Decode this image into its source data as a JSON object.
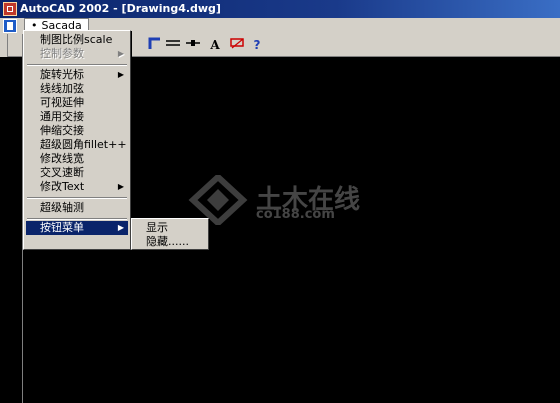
{
  "window": {
    "title": "AutoCAD 2002 - [Drawing4.dwg]"
  },
  "menubar": {
    "active_menu": "Sacada"
  },
  "toolbar": {
    "tools": [
      "rectangle-corner-icon",
      "parallel-lines-icon",
      "break-line-icon",
      "text-style-icon",
      "dimension-icon",
      "help-icon"
    ],
    "help_label": "?",
    "text_label": "A"
  },
  "menu": {
    "items": [
      {
        "label": "制图比例scale",
        "enabled": true,
        "submenu": false
      },
      {
        "label": "控制参数",
        "enabled": false,
        "submenu": true
      },
      {
        "label": "旋转光标",
        "enabled": true,
        "submenu": true
      },
      {
        "label": "线线加弦",
        "enabled": true,
        "submenu": false
      },
      {
        "label": "可视延伸",
        "enabled": true,
        "submenu": false
      },
      {
        "label": "通用交接",
        "enabled": true,
        "submenu": false
      },
      {
        "label": "伸缩交接",
        "enabled": true,
        "submenu": false
      },
      {
        "label": "超级圆角fillet++",
        "enabled": true,
        "submenu": false
      },
      {
        "label": "修改线宽",
        "enabled": true,
        "submenu": false
      },
      {
        "label": "交叉速断",
        "enabled": true,
        "submenu": false
      },
      {
        "label": "修改Text",
        "enabled": true,
        "submenu": true
      },
      {
        "label": "超级轴测",
        "enabled": true,
        "submenu": false
      },
      {
        "label": "按钮菜单",
        "enabled": true,
        "submenu": true,
        "active": true
      }
    ]
  },
  "submenu": {
    "items": [
      {
        "label": "显示"
      },
      {
        "label": "隐藏......"
      }
    ]
  },
  "watermark": {
    "text": "土木在线",
    "sub": "co188.com"
  },
  "colors": {
    "titlebar": "#0a246a",
    "menu_bg": "#d4d0c8",
    "canvas": "#000000",
    "highlight": "#0a246a"
  }
}
